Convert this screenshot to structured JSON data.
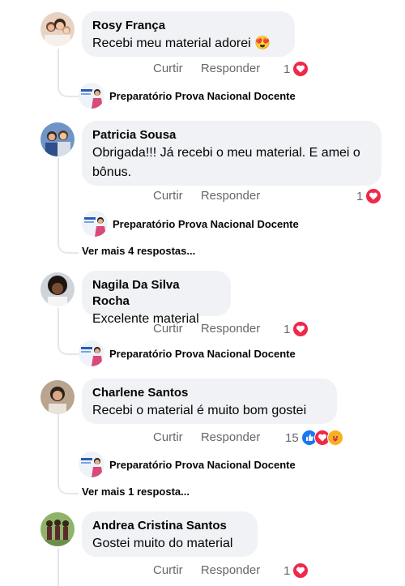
{
  "comments": [
    {
      "author": "Rosy França",
      "text": "Recebi meu material adorei 😍",
      "like": "Curtir",
      "reply": "Responder",
      "reactions_count": "1"
    },
    {
      "author": "Patricia Sousa",
      "text": "Obrigada!!! Já recebi o meu material. E amei o bônus.",
      "like": "Curtir",
      "reply": "Responder",
      "reactions_count": "1"
    },
    {
      "author": "Nagila Da Silva Rocha",
      "text": "Excelente material",
      "like": "Curtir",
      "reply": "Responder",
      "reactions_count": "1"
    },
    {
      "author": "Charlene Santos",
      "text": "Recebi o material é muito bom gostei",
      "like": "Curtir",
      "reply": "Responder",
      "reactions_count": "15"
    },
    {
      "author": "Andrea Cristina Santos",
      "text": "Gostei muito do material",
      "like": "Curtir",
      "reply": "Responder",
      "reactions_count": "1"
    }
  ],
  "page_reply_name": "Preparatório Prova Nacional Docente",
  "more_replies": [
    "Ver mais 4 respostas...",
    "Ver mais 1 resposta..."
  ],
  "colors": {
    "bubble": "#f0f2f5",
    "meta": "#65676b",
    "heart": "#f02849",
    "like": "#1877f2"
  },
  "icons": {
    "heart": "heart-icon",
    "like": "like-icon",
    "care": "care-icon"
  }
}
